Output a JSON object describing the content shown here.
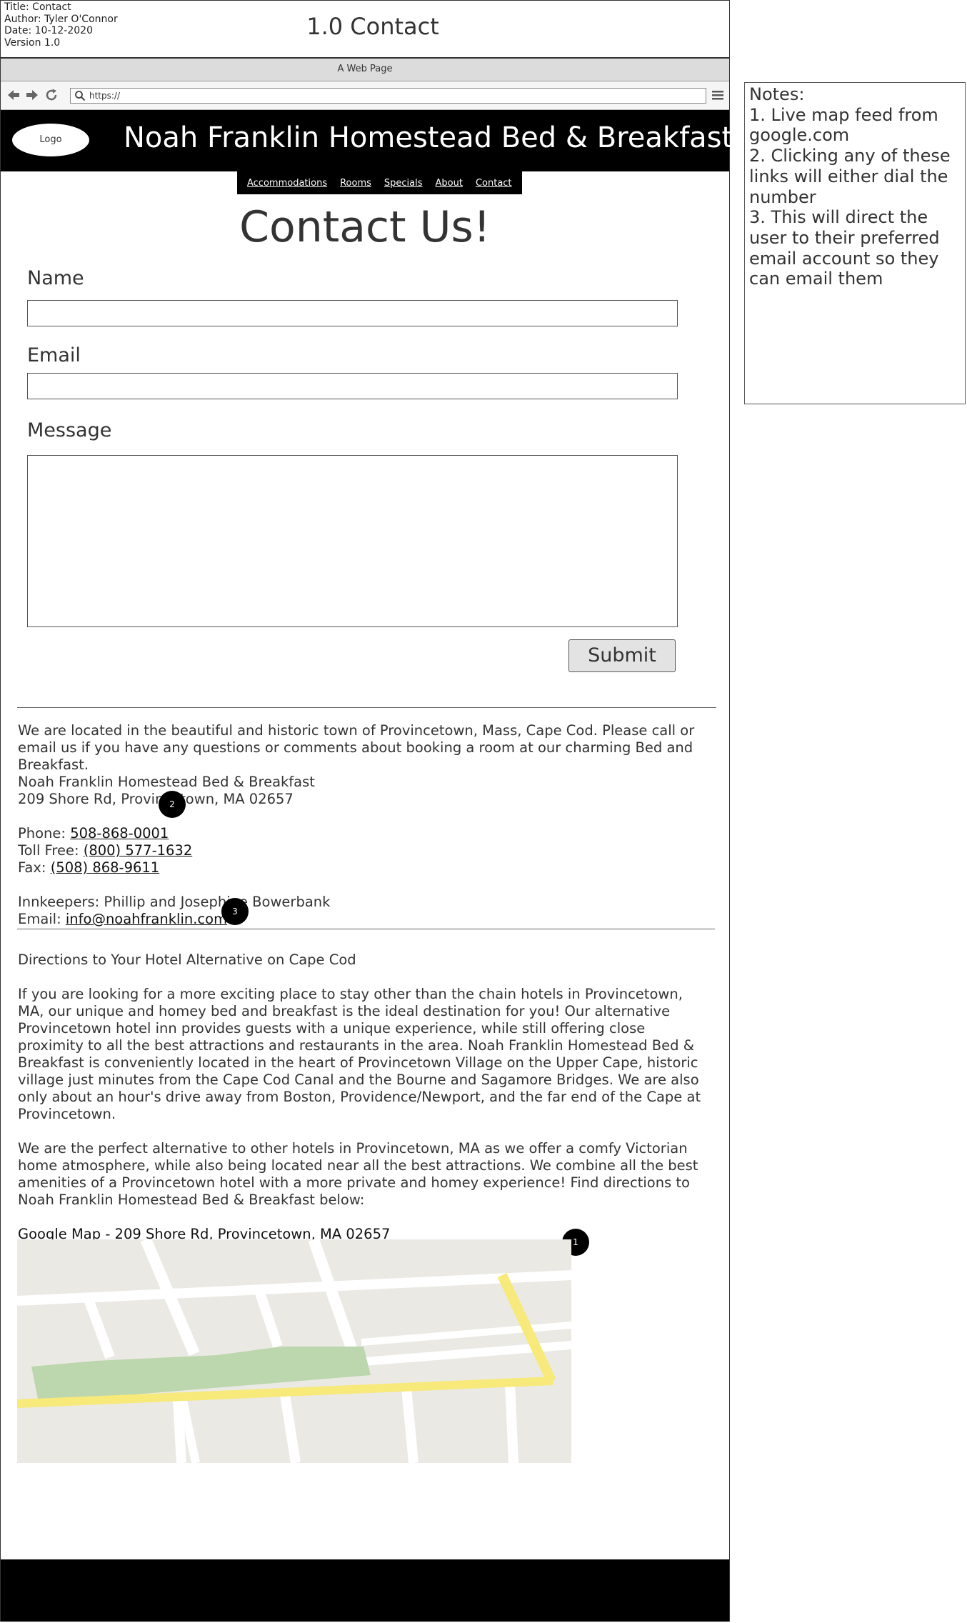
{
  "meta": {
    "title_line": "Title: Contact",
    "author_line": "Author: Tyler O'Connor",
    "date_line": "Date: 10-12-2020",
    "version_line": "Version 1.0"
  },
  "page_title": "1.0 Contact",
  "browser": {
    "window_title": "A Web Page",
    "url": "https://",
    "back_icon": "arrow-left",
    "forward_icon": "arrow-right",
    "reload_icon": "refresh",
    "search_icon": "magnifier",
    "menu_icon": "hamburger"
  },
  "site": {
    "logo_label": "Logo",
    "name": "Noah Franklin Homestead Bed & Breakfast"
  },
  "nav": {
    "items": [
      "Accommodations",
      "Rooms",
      "Specials",
      "About",
      "Contact"
    ]
  },
  "form": {
    "heading": "Contact Us!",
    "name_label": "Name",
    "name_value": "",
    "email_label": "Email",
    "email_value": "",
    "message_label": "Message",
    "message_value": "",
    "submit_label": "Submit"
  },
  "contact": {
    "intro": "We are located in the beautiful and historic town of Provincetown, Mass, Cape Cod. Please call or email us if you have any questions or comments about booking a room at our charming Bed and Breakfast.",
    "business_name": "Noah Franklin Homestead Bed & Breakfast",
    "address": "209 Shore Rd, Provincetown, MA 02657",
    "phone_label": "Phone: ",
    "phone": "508-868-0001",
    "toll_free_label": "Toll Free: ",
    "toll_free": "(800) 577-1632",
    "fax_label": "Fax: ",
    "fax": "(508) 868-9611",
    "innkeepers": "Innkeepers: Phillip and Josephine Bowerbank",
    "email_label": "Email: ",
    "email": "info@noahfranklin.com"
  },
  "directions": {
    "heading": "Directions to Your Hotel Alternative on Cape Cod",
    "paragraph1": "If you are looking for a more exciting place to stay other than the chain hotels in Provincetown, MA, our unique and homey bed and breakfast is the ideal destination for you! Our alternative Provincetown hotel inn provides guests with a unique experience, while still offering close proximity to all the best attractions and restaurants in the area. Noah Franklin Homestead Bed & Breakfast is conveniently located in the heart of Provincetown Village on the Upper Cape, historic village just minutes from the Cape Cod Canal and the Bourne and Sagamore Bridges. We are also only about an hour's drive away from Boston, Providence/Newport, and the far end of the Cape at Provincetown.",
    "paragraph2": "We are the perfect alternative to other hotels in Provincetown, MA as we offer a comfy Victorian home atmosphere, while also being located near all the best attractions. We combine all the best amenities of a Provincetown hotel with a more private and homey experience! Find directions to Noah Franklin Homestead Bed & Breakfast below:",
    "map_link": "Google Map - 209 Shore Rd, Provincetown, MA 02657"
  },
  "markers": {
    "map": "1",
    "phone": "2",
    "email": "3"
  },
  "notes": {
    "heading": "Notes:",
    "items": [
      "1. Live map feed from google.com",
      "2. Clicking any of these links will either dial the number",
      "3. This will direct the user to their preferred email account so they can email them"
    ]
  },
  "colors": {
    "banner": "#000000",
    "map_land": "#ebe9e4",
    "map_road_major": "#f7e97a",
    "map_park": "#bcd6ae",
    "map_road": "#ffffff"
  }
}
